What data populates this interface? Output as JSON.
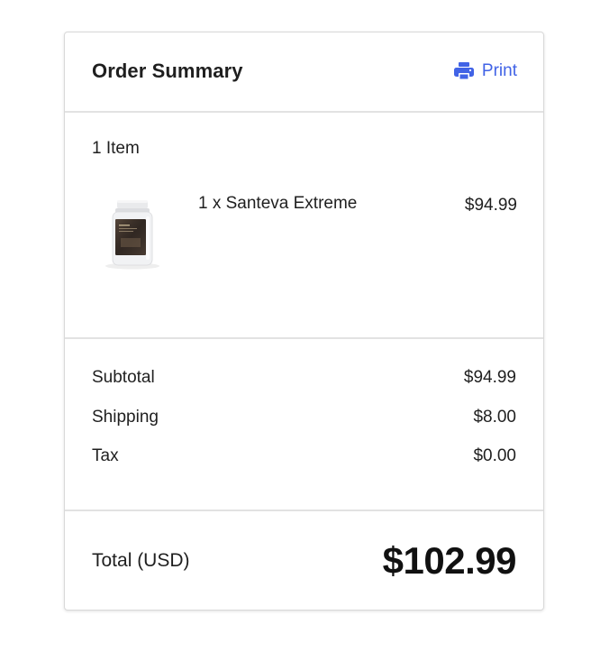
{
  "header": {
    "title": "Order Summary",
    "print_label": "Print",
    "print_icon": "printer-icon",
    "accent_color": "#4163e6"
  },
  "items": {
    "count_label": "1 Item",
    "list": [
      {
        "name": "1 x Santeva Extreme",
        "price": "$94.99",
        "image_icon": "supplement-bottle"
      }
    ]
  },
  "totals": {
    "subtotal_label": "Subtotal",
    "subtotal_value": "$94.99",
    "shipping_label": "Shipping",
    "shipping_value": "$8.00",
    "tax_label": "Tax",
    "tax_value": "$0.00"
  },
  "grand_total": {
    "label": "Total (USD)",
    "value": "$102.99"
  }
}
